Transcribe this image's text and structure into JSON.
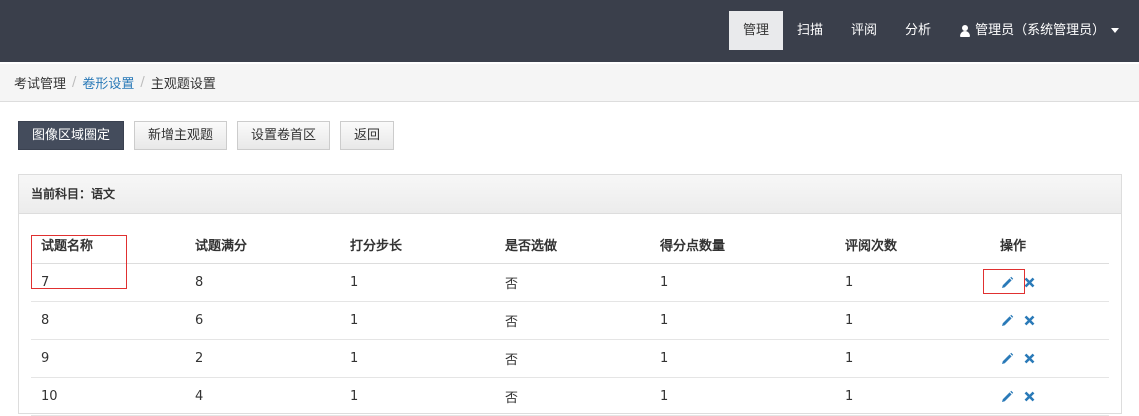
{
  "nav": {
    "items": [
      "管理",
      "扫描",
      "评阅",
      "分析"
    ],
    "active_index": 0,
    "user_label": "管理员（系统管理员）"
  },
  "breadcrumb": {
    "items": [
      "考试管理",
      "卷形设置",
      "主观题设置"
    ],
    "separator": "/"
  },
  "toolbar": {
    "buttons": [
      "图像区域圈定",
      "新增主观题",
      "设置卷首区",
      "返回"
    ]
  },
  "panel": {
    "title": "当前科目：语文"
  },
  "table": {
    "columns": [
      "试题名称",
      "试题满分",
      "打分步长",
      "是否选做",
      "得分点数量",
      "评阅次数",
      "操作"
    ],
    "rows": [
      [
        "7",
        "8",
        "1",
        "否",
        "1",
        "1"
      ],
      [
        "8",
        "6",
        "1",
        "否",
        "1",
        "1"
      ],
      [
        "9",
        "2",
        "1",
        "否",
        "1",
        "1"
      ],
      [
        "10",
        "4",
        "1",
        "否",
        "1",
        "1"
      ]
    ]
  },
  "colors": {
    "topbar": "#3a3f4b",
    "primary_button": "#444c5c",
    "link": "#2a7ab8",
    "action_icon": "#2a7ab8",
    "highlight": "#e03030"
  },
  "icons": [
    "user-icon",
    "caret-down-icon",
    "pencil-icon",
    "close-icon"
  ]
}
